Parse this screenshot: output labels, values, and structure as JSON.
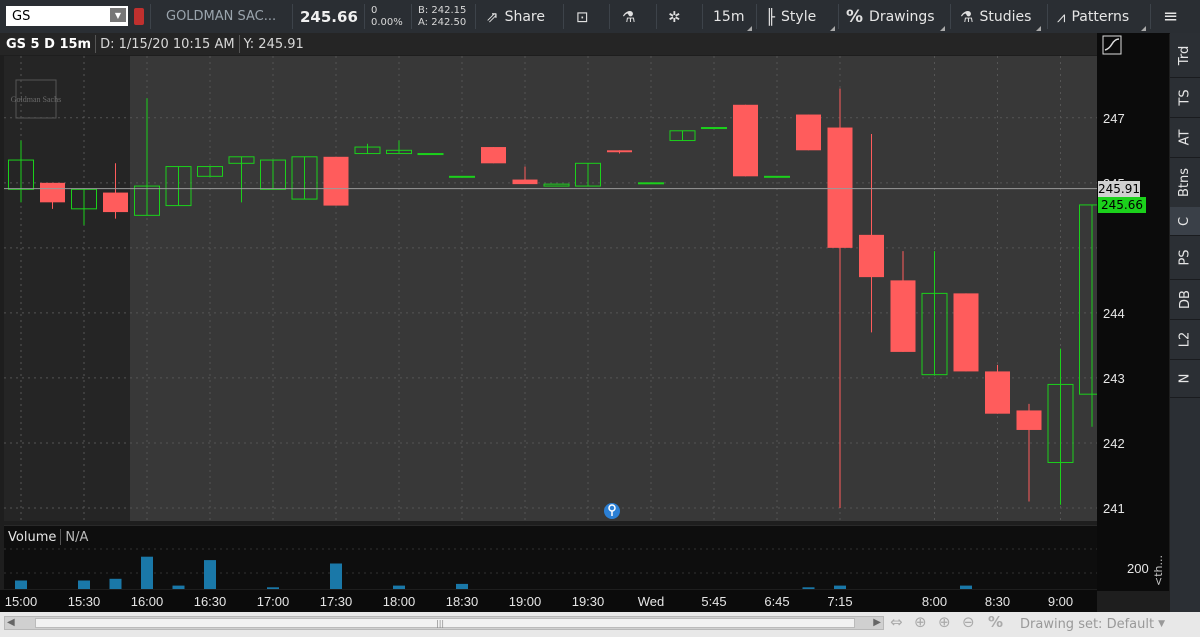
{
  "toolbar": {
    "symbol": "GS",
    "company": "GOLDMAN SAC...",
    "last": "245.66",
    "change": "0",
    "change_pct": "0.00%",
    "bid": "B: 242.15",
    "ask": "A: 242.50",
    "share": "Share",
    "timeframe": "15m",
    "style": "Style",
    "drawings": "Drawings",
    "studies": "Studies",
    "patterns": "Patterns"
  },
  "header": {
    "symbol_period": "GS 5 D 15m",
    "date": "D: 1/15/20 10:15 AM",
    "y": "Y: 245.91"
  },
  "logo_text": "Goldman Sachs",
  "crosshair_label": "245.91",
  "price_label": "245.66",
  "volume": {
    "label": "Volume",
    "value": "N/A",
    "axis_label": "200"
  },
  "sidebar": [
    "Trd",
    "TS",
    "AT",
    "Btns",
    "C",
    "PS",
    "DB",
    "L2",
    "N"
  ],
  "sidebar_active": "C",
  "sidebar_collapse": "<th...",
  "drawing_set": "Drawing set: Default",
  "colors": {
    "up": "#1bd11b",
    "down": "#ff5c5c",
    "bg": "#383838",
    "afterhours": "#252525",
    "volume": "#1a78a8"
  },
  "chart_data": {
    "type": "candlestick",
    "ylim": [
      240.8,
      247.95
    ],
    "yticks": [
      241,
      242,
      243,
      244,
      245,
      246,
      247
    ],
    "ytick_labels": [
      "241",
      "242",
      "243",
      "244",
      "",
      "245",
      "247"
    ],
    "xticks": [
      {
        "label": "15:00",
        "i": 0
      },
      {
        "label": "15:30",
        "i": 2
      },
      {
        "label": "16:00",
        "i": 4
      },
      {
        "label": "16:30",
        "i": 6
      },
      {
        "label": "17:00",
        "i": 8
      },
      {
        "label": "17:30",
        "i": 10
      },
      {
        "label": "18:00",
        "i": 12
      },
      {
        "label": "18:30",
        "i": 14
      },
      {
        "label": "19:00",
        "i": 16
      },
      {
        "label": "19:30",
        "i": 18
      },
      {
        "label": "Wed",
        "i": 20
      },
      {
        "label": "5:45",
        "i": 22
      },
      {
        "label": "6:45",
        "i": 24
      },
      {
        "label": "7:15",
        "i": 26
      },
      {
        "label": "8:00",
        "i": 29
      },
      {
        "label": "8:30",
        "i": 31
      },
      {
        "label": "9:00",
        "i": 33
      }
    ],
    "candles": [
      {
        "o": 245.9,
        "h": 246.65,
        "l": 245.7,
        "c": 246.35
      },
      {
        "o": 246.0,
        "h": 246.0,
        "l": 245.6,
        "c": 245.7
      },
      {
        "o": 245.6,
        "h": 245.9,
        "l": 245.35,
        "c": 245.9
      },
      {
        "o": 245.85,
        "h": 246.3,
        "l": 245.45,
        "c": 245.55
      },
      {
        "o": 245.5,
        "h": 247.3,
        "l": 245.5,
        "c": 245.95
      },
      {
        "o": 245.65,
        "h": 246.25,
        "l": 245.65,
        "c": 246.25
      },
      {
        "o": 246.1,
        "h": 246.25,
        "l": 246.1,
        "c": 246.25
      },
      {
        "o": 246.3,
        "h": 246.4,
        "l": 245.7,
        "c": 246.4
      },
      {
        "o": 245.9,
        "h": 246.35,
        "l": 245.9,
        "c": 246.35
      },
      {
        "o": 245.75,
        "h": 246.4,
        "l": 245.75,
        "c": 246.4
      },
      {
        "o": 246.4,
        "h": 246.4,
        "l": 245.65,
        "c": 245.65
      },
      {
        "o": 246.45,
        "h": 246.6,
        "l": 246.45,
        "c": 246.55
      },
      {
        "o": 246.45,
        "h": 246.65,
        "l": 246.45,
        "c": 246.5
      },
      {
        "o": 246.45,
        "h": 246.45,
        "l": 246.45,
        "c": 246.45
      },
      {
        "o": 246.1,
        "h": 246.1,
        "l": 246.1,
        "c": 246.1
      },
      {
        "o": 246.55,
        "h": 246.55,
        "l": 246.3,
        "c": 246.3
      },
      {
        "o": 246.05,
        "h": 246.25,
        "l": 246.0,
        "c": 245.98
      },
      {
        "o": 245.95,
        "h": 245.95,
        "l": 245.95,
        "c": 245.98
      },
      {
        "o": 245.95,
        "h": 246.3,
        "l": 245.95,
        "c": 246.3
      },
      {
        "o": 246.5,
        "h": 246.5,
        "l": 246.45,
        "c": 246.47
      },
      {
        "o": 246.0,
        "h": 246.0,
        "l": 246.0,
        "c": 246.0
      },
      {
        "o": 246.65,
        "h": 246.8,
        "l": 246.65,
        "c": 246.8
      },
      {
        "o": 246.85,
        "h": 246.85,
        "l": 246.85,
        "c": 246.85
      },
      {
        "o": 247.2,
        "h": 247.2,
        "l": 246.1,
        "c": 246.1
      },
      {
        "o": 246.1,
        "h": 246.1,
        "l": 246.1,
        "c": 246.1
      },
      {
        "o": 247.05,
        "h": 247.05,
        "l": 246.5,
        "c": 246.5
      },
      {
        "o": 246.85,
        "h": 247.45,
        "l": 241.0,
        "c": 245.0
      },
      {
        "o": 245.2,
        "h": 246.75,
        "l": 243.7,
        "c": 244.55
      },
      {
        "o": 244.5,
        "h": 244.95,
        "l": 243.4,
        "c": 243.4
      },
      {
        "o": 243.05,
        "h": 244.95,
        "l": 243.05,
        "c": 244.3
      },
      {
        "o": 244.3,
        "h": 244.3,
        "l": 243.1,
        "c": 243.1
      },
      {
        "o": 243.1,
        "h": 243.2,
        "l": 242.45,
        "c": 242.45
      },
      {
        "o": 242.5,
        "h": 242.6,
        "l": 241.1,
        "c": 242.2
      },
      {
        "o": 241.7,
        "h": 243.45,
        "l": 241.05,
        "c": 242.9
      },
      {
        "o": 242.75,
        "h": 245.66,
        "l": 242.25,
        "c": 245.66
      }
    ],
    "volume": [
      0.25,
      0.0,
      0.25,
      0.3,
      0.95,
      0.1,
      0.85,
      0.0,
      0.05,
      0.0,
      0.75,
      0.0,
      0.1,
      0.0,
      0.15,
      0.0,
      0.0,
      0.0,
      0.0,
      0.0,
      0.0,
      0.0,
      0.0,
      0.0,
      0.0,
      0.05,
      0.1,
      0.0,
      0.0,
      0.0,
      0.1,
      0.0,
      0.0,
      0.0,
      0.0,
      0.05,
      0.2
    ],
    "volume_ymax": 1.0
  }
}
